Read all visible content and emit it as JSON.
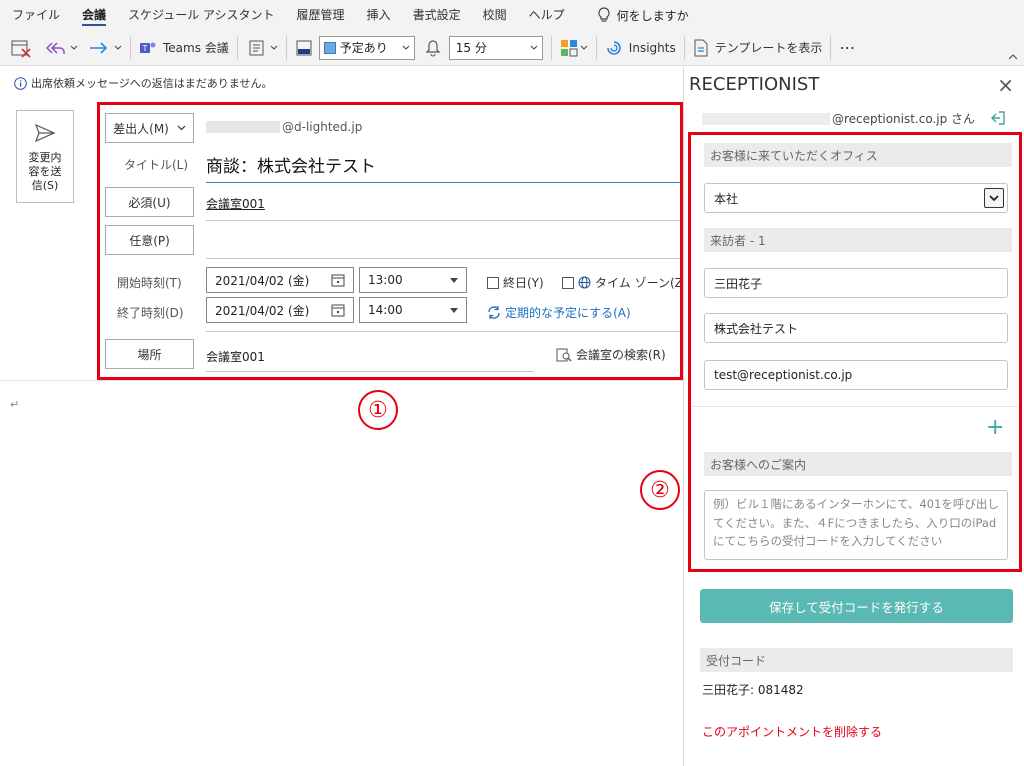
{
  "menu": {
    "items": [
      "ファイル",
      "会議",
      "スケジュール アシスタント",
      "履歴管理",
      "挿入",
      "書式設定",
      "校閲",
      "ヘルプ"
    ],
    "tell_me": "何をしますか"
  },
  "toolbar": {
    "teams_label": "Teams 会議",
    "show_as_value": "予定あり",
    "reminder_value": "15 分",
    "insights_label": "Insights",
    "template_label": "テンプレートを表示",
    "more_label": "⋯"
  },
  "infobar": {
    "text": "出席依頼メッセージへの返信はまだありません。"
  },
  "send_button": {
    "label": "変更内\n容を送\n信(S)"
  },
  "form": {
    "from_label": "差出人(M)",
    "from_value": "@d-lighted.jp",
    "title_label": "タイトル(L)",
    "title_value": "商談：株式会社テスト",
    "required_label": "必須(U)",
    "required_value": "会議室001",
    "optional_label": "任意(P)",
    "start_label": "開始時刻(T)",
    "start_date": "2021/04/02 (金)",
    "start_time": "13:00",
    "end_label": "終了時刻(D)",
    "end_date": "2021/04/02 (金)",
    "end_time": "14:00",
    "allday_label": "終日(Y)",
    "timezone_label": "タイム ゾーン(Z)",
    "recurring_label": "定期的な予定にする(A)",
    "location_label": "場所",
    "location_value": "会議室001",
    "room_search_label": "会議室の検索(R)"
  },
  "body": {
    "mark": "↵"
  },
  "annotations": {
    "one": "①",
    "two": "②"
  },
  "panel": {
    "title": "RECEPTIONIST",
    "close": "×",
    "account": "@receptionist.co.jp さん",
    "office_section": "お客様に来ていただくオフィス",
    "office_value": "本社",
    "visitor_section": "来訪者 - 1",
    "visitor_name": "三田花子",
    "visitor_company": "株式会社テスト",
    "visitor_email": "test@receptionist.co.jp",
    "add": "+",
    "guide_section": "お客様へのご案内",
    "guide_placeholder": "例）ビル１階にあるインターホンにて、401を呼び出してください。また、４Fにつきましたら、入り口のiPadにてこちらの受付コードを入力してください",
    "save_button": "保存して受付コードを発行する",
    "code_section": "受付コード",
    "code_value": "三田花子: 081482",
    "delete_link": "このアポイントメントを削除する"
  },
  "colors": {
    "accent": "#2b579a",
    "red": "#e50012",
    "teal": "#5ab9b2",
    "link": "#1a6fc0"
  }
}
